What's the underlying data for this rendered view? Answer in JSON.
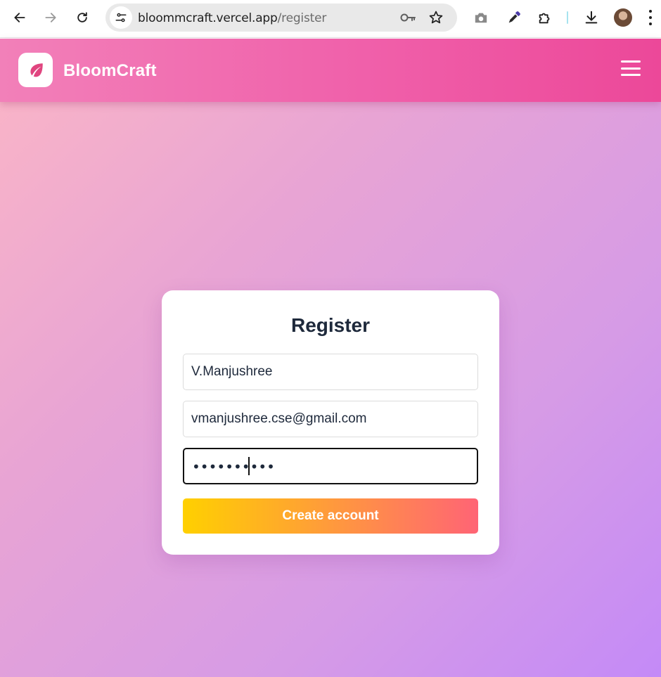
{
  "browser": {
    "url_host": "bloommcraft.vercel.app",
    "url_path": "/register",
    "icons": [
      "back-arrow-icon",
      "forward-arrow-icon",
      "reload-icon",
      "site-settings-icon",
      "password-key-icon",
      "bookmark-star-icon",
      "camera-icon",
      "eyedropper-icon",
      "extensions-icon",
      "download-icon",
      "profile-avatar",
      "more-menu-icon"
    ]
  },
  "header": {
    "brand": "BloomCraft",
    "logo_icon": "leaf-icon",
    "menu_icon": "hamburger-menu-icon"
  },
  "form": {
    "title": "Register",
    "name_value": "V.Manjushree",
    "email_value": "vmanjushree.cse@gmail.com",
    "password_mask": "••••••••••",
    "submit_label": "Create account"
  },
  "colors": {
    "header_start": "#f280b9",
    "header_end": "#ec4899",
    "button_start": "#ffd000",
    "button_end": "#ff6475",
    "title": "#1e293b"
  }
}
